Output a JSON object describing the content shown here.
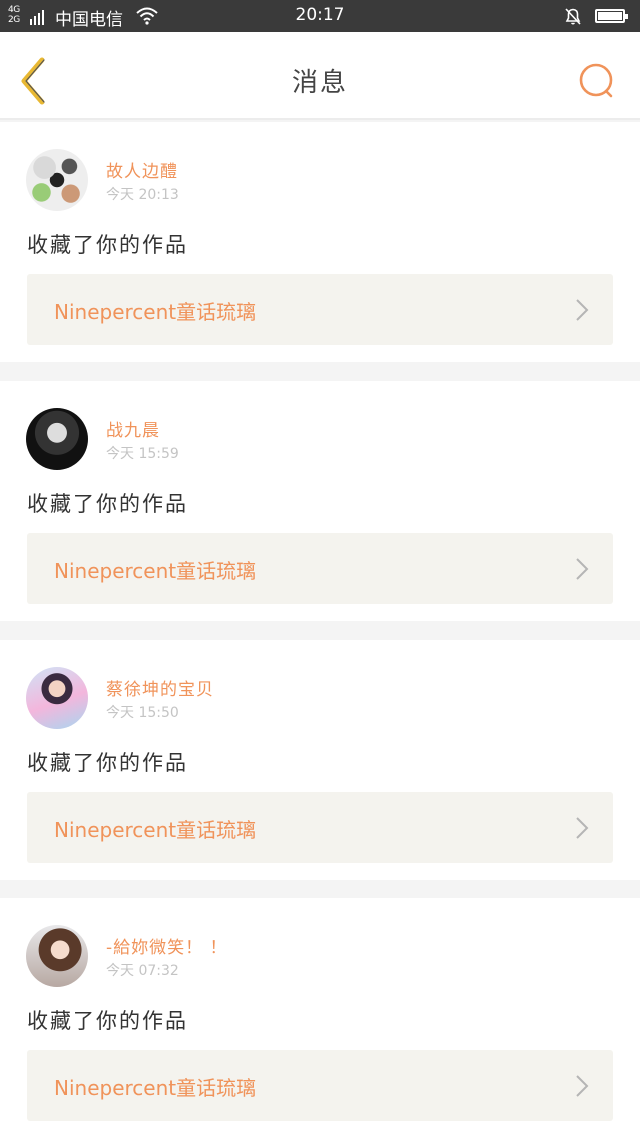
{
  "status_bar": {
    "network": "4G\n2G",
    "carrier": "中国电信",
    "time": "20:17"
  },
  "nav": {
    "title": "消息",
    "back_icon": "chevron-left-icon",
    "search_icon": "search-icon"
  },
  "colors": {
    "accent": "#f0935a",
    "back": "#e8b833",
    "card_link_bg": "#f4f3ee"
  },
  "messages": [
    {
      "user": "故人边醴",
      "time": "今天 20:13",
      "action": "收藏了你的作品",
      "work": "Ninepercent童话琉璃"
    },
    {
      "user": "战九晨",
      "time": "今天 15:59",
      "action": "收藏了你的作品",
      "work": "Ninepercent童话琉璃"
    },
    {
      "user": "蔡徐坤的宝贝",
      "time": "今天 15:50",
      "action": "收藏了你的作品",
      "work": "Ninepercent童话琉璃"
    },
    {
      "user": "-給妳微笑！ ！",
      "time": "今天 07:32",
      "action": "收藏了你的作品",
      "work": "Ninepercent童话琉璃"
    }
  ]
}
